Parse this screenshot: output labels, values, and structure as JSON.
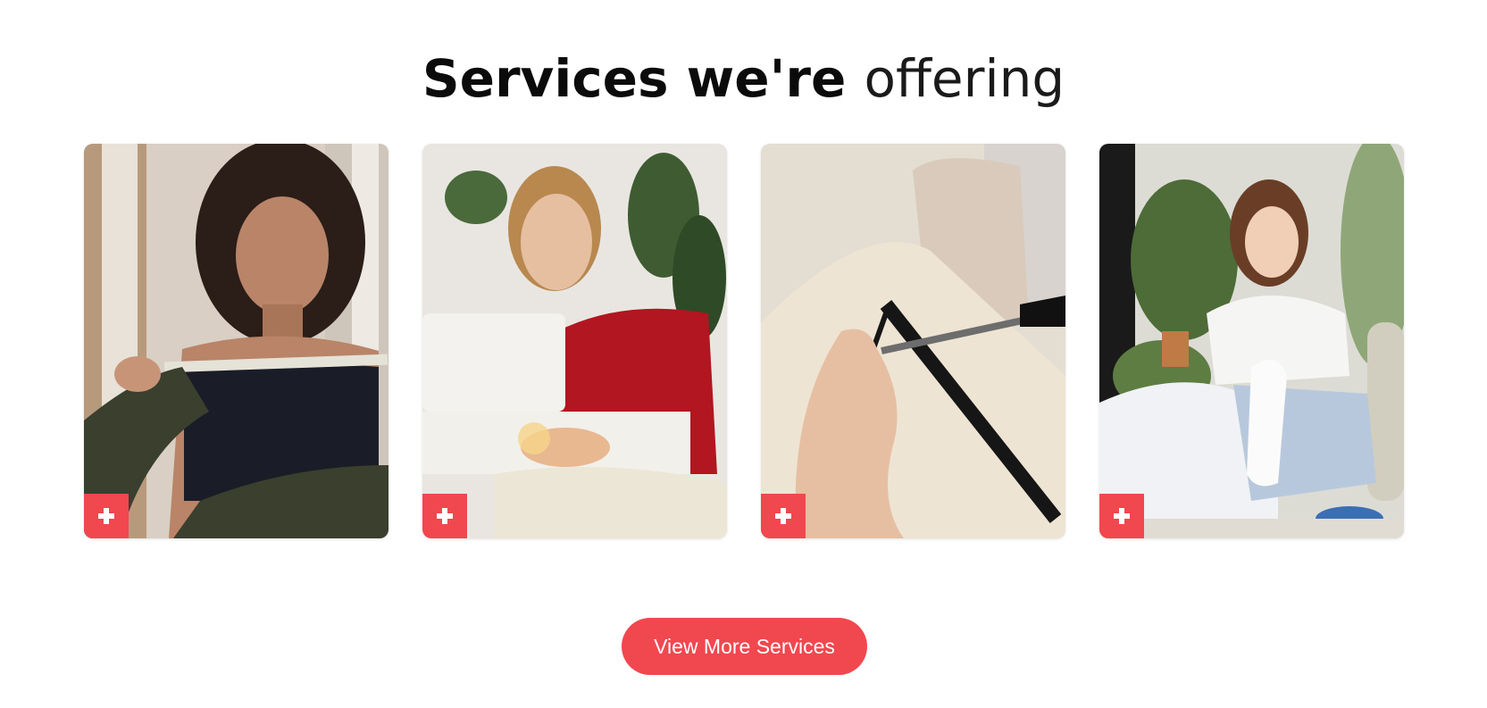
{
  "heading": {
    "bold": "Services we're",
    "light": "offering"
  },
  "colors": {
    "accent": "#f1474f",
    "text": "#0b0b0b",
    "background": "#ffffff"
  },
  "cards": [
    {
      "image": "woman-measured-with-tape-photo",
      "icon": "plus-icon"
    },
    {
      "image": "woman-at-sewing-machine-photo",
      "icon": "plus-icon"
    },
    {
      "image": "cutting-fabric-on-mannequin-photo",
      "icon": "plus-icon"
    },
    {
      "image": "woman-hand-sewing-photo",
      "icon": "plus-icon"
    }
  ],
  "cta": {
    "label": "View More Services"
  }
}
